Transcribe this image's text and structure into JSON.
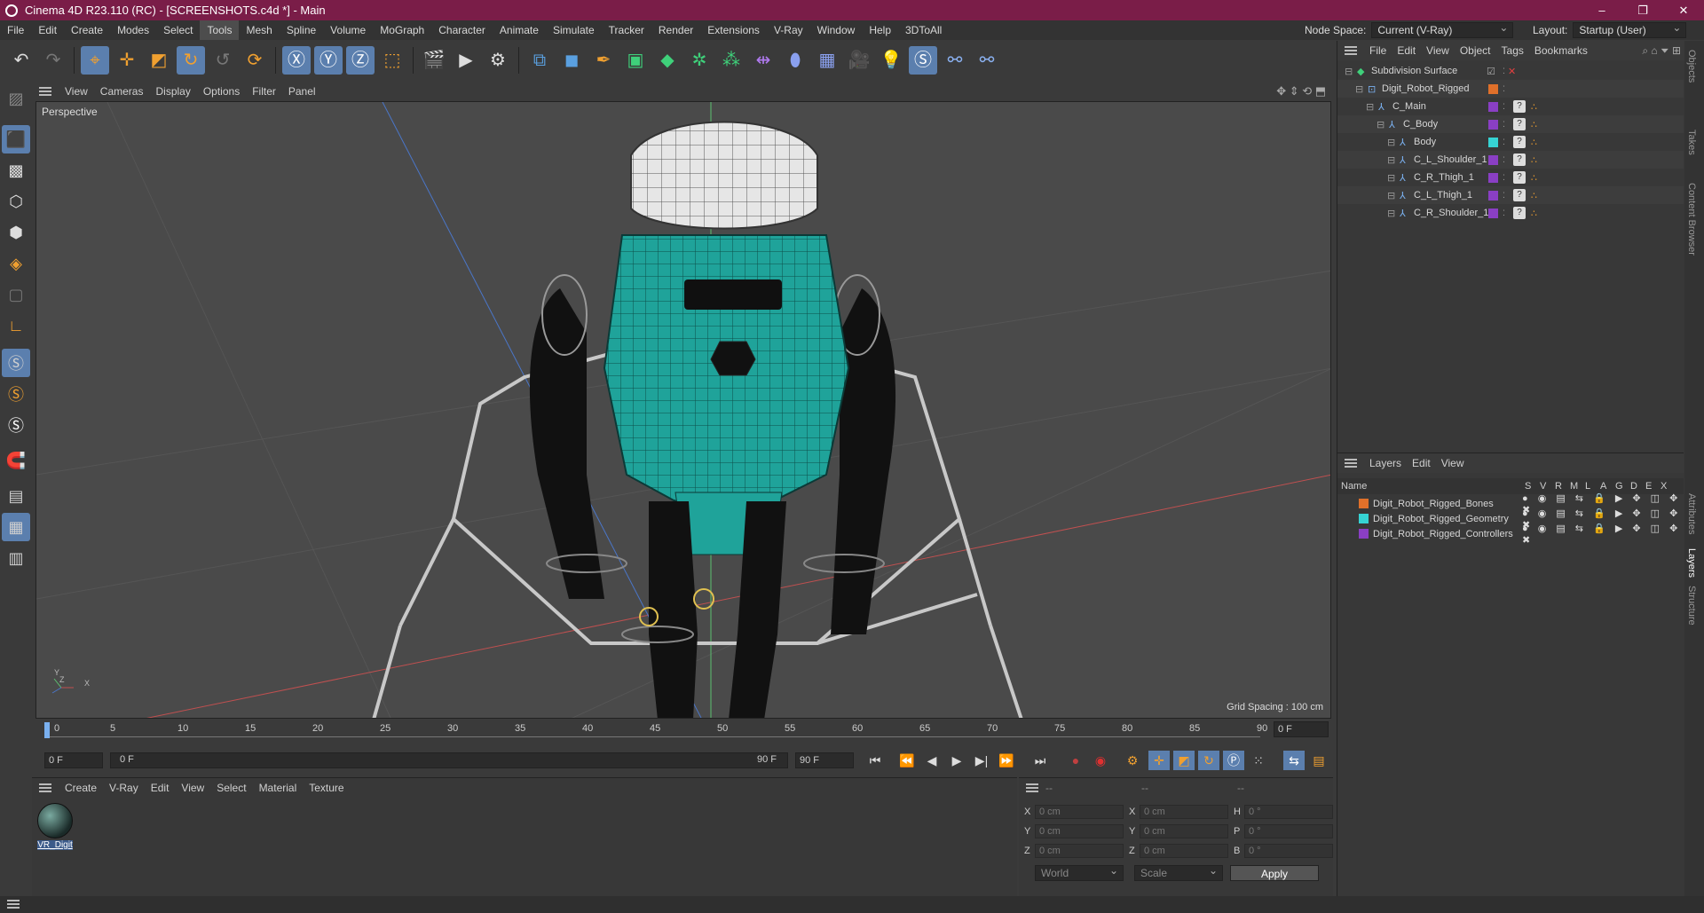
{
  "window": {
    "title": "Cinema 4D R23.110 (RC) - [SCREENSHOTS.c4d *] - Main",
    "controls": [
      "–",
      "❐",
      "✕"
    ]
  },
  "menubar": {
    "items": [
      "File",
      "Edit",
      "Create",
      "Modes",
      "Select",
      "Tools",
      "Mesh",
      "Spline",
      "Volume",
      "MoGraph",
      "Character",
      "Animate",
      "Simulate",
      "Tracker",
      "Render",
      "Extensions",
      "V-Ray",
      "Window",
      "Help",
      "3DToAll"
    ],
    "active": "Tools",
    "node_space_label": "Node Space:",
    "node_space_value": "Current (V-Ray)",
    "layout_label": "Layout:",
    "layout_value": "Startup (User)"
  },
  "viewport": {
    "menu": [
      "View",
      "Cameras",
      "Display",
      "Options",
      "Filter",
      "Panel"
    ],
    "label": "Perspective",
    "grid_spacing": "Grid Spacing : 100 cm",
    "axis_labels": [
      "Y",
      "Z",
      "X"
    ]
  },
  "timeline": {
    "ticks": [
      "0",
      "5",
      "10",
      "15",
      "20",
      "25",
      "30",
      "35",
      "40",
      "45",
      "50",
      "55",
      "60",
      "65",
      "70",
      "75",
      "80",
      "85",
      "90"
    ],
    "current_frame": "0 F",
    "start_field": "0 F",
    "range_start": "0 F",
    "range_end": "90 F",
    "end_field": "90 F"
  },
  "material_panel": {
    "menu": [
      "Create",
      "V-Ray",
      "Edit",
      "View",
      "Select",
      "Material",
      "Texture"
    ],
    "material_name": "VR_Digit"
  },
  "coords": {
    "headers": [
      "--",
      "--",
      "--"
    ],
    "rows": [
      {
        "a": "X",
        "av": "0 cm",
        "b": "X",
        "bv": "0 cm",
        "c": "H",
        "cv": "0 °"
      },
      {
        "a": "Y",
        "av": "0 cm",
        "b": "Y",
        "bv": "0 cm",
        "c": "P",
        "cv": "0 °"
      },
      {
        "a": "Z",
        "av": "0 cm",
        "b": "Z",
        "bv": "0 cm",
        "c": "B",
        "cv": "0 °"
      }
    ],
    "world": "World",
    "scale": "Scale",
    "apply": "Apply"
  },
  "objects_panel": {
    "menu": [
      "File",
      "Edit",
      "View",
      "Object",
      "Tags",
      "Bookmarks"
    ],
    "items": [
      {
        "name": "Subdivision Surface",
        "color": "",
        "indent": 0
      },
      {
        "name": "Digit_Robot_Rigged",
        "color": "#e0702a",
        "indent": 1
      },
      {
        "name": "C_Main",
        "color": "#8a3fc4",
        "indent": 2
      },
      {
        "name": "C_Body",
        "color": "#8a3fc4",
        "indent": 3
      },
      {
        "name": "Body",
        "color": "#36d3d3",
        "indent": 4
      },
      {
        "name": "C_L_Shoulder_1",
        "color": "#8a3fc4",
        "indent": 4
      },
      {
        "name": "C_R_Thigh_1",
        "color": "#8a3fc4",
        "indent": 4
      },
      {
        "name": "C_L_Thigh_1",
        "color": "#8a3fc4",
        "indent": 4
      },
      {
        "name": "C_R_Shoulder_1",
        "color": "#8a3fc4",
        "indent": 4
      }
    ]
  },
  "layers_panel": {
    "menu": [
      "Layers",
      "Edit",
      "View"
    ],
    "name_header": "Name",
    "columns": [
      "S",
      "V",
      "R",
      "M",
      "L",
      "A",
      "G",
      "D",
      "E",
      "X"
    ],
    "layers": [
      {
        "name": "Digit_Robot_Rigged_Bones",
        "color": "#e0702a"
      },
      {
        "name": "Digit_Robot_Rigged_Geometry",
        "color": "#36d3d3"
      },
      {
        "name": "Digit_Robot_Rigged_Controllers",
        "color": "#8a3fc4"
      }
    ]
  },
  "side_tabs": [
    "Objects",
    "Takes",
    "Content Browser",
    "Attributes",
    "Layers",
    "Structure"
  ],
  "active_side_tab": "Layers"
}
